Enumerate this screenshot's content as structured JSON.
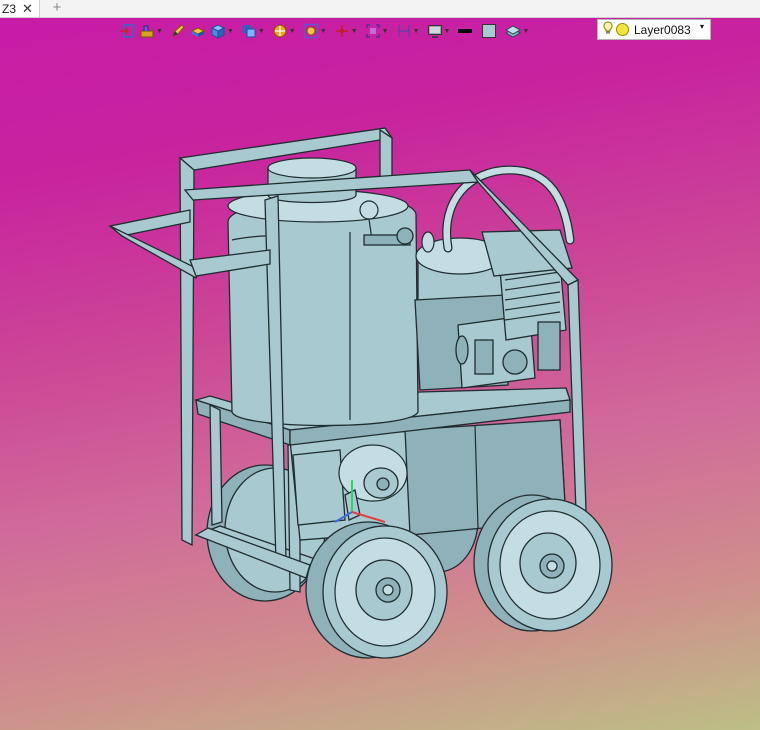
{
  "tabs": [
    {
      "label": "Z3",
      "close": "✕"
    }
  ],
  "new_tab_symbol": "+",
  "toolbar": {
    "buttons": [
      {
        "icon": "exit-sketch-icon",
        "has_dropdown": false
      },
      {
        "icon": "construct-icon",
        "has_dropdown": true
      },
      {
        "icon": "pencil-icon",
        "has_dropdown": false
      },
      {
        "icon": "block-icon",
        "has_dropdown": false
      },
      {
        "icon": "cube-icon",
        "has_dropdown": true
      },
      {
        "icon": "boolean-icon",
        "has_dropdown": true
      },
      {
        "icon": "section-icon",
        "has_dropdown": true
      },
      {
        "icon": "visual-style-icon",
        "has_dropdown": true
      },
      {
        "icon": "origin-icon",
        "has_dropdown": true
      },
      {
        "icon": "fit-view-icon",
        "has_dropdown": true
      },
      {
        "icon": "measure-icon",
        "has_dropdown": true
      },
      {
        "icon": "display-icon",
        "has_dropdown": true
      },
      {
        "icon": "line-color-icon",
        "has_dropdown": false
      },
      {
        "icon": "fill-color-icon",
        "has_dropdown": false
      },
      {
        "icon": "layer-manager-icon",
        "has_dropdown": true
      }
    ],
    "colors": {
      "line_color": "#000000",
      "fill_color": "#a9c9d0"
    }
  },
  "layer_selector": {
    "value": "Layer0083",
    "dropdown": "▾"
  },
  "viewport": {
    "background_top": "#c81aa8",
    "background_bottom": "#bcbf86",
    "model_color": "#a9c9d0"
  }
}
